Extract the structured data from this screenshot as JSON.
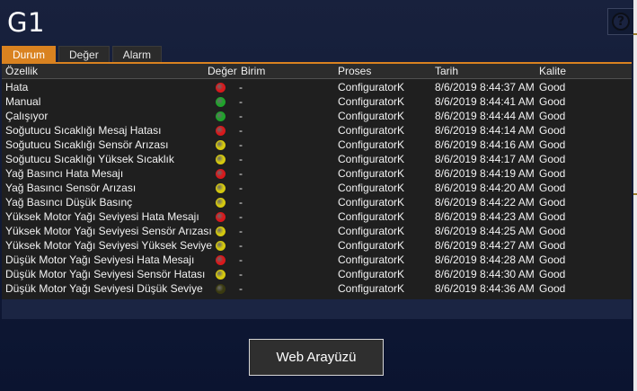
{
  "window": {
    "title": "G1"
  },
  "tabs": [
    {
      "label": "Durum",
      "active": true
    },
    {
      "label": "Değer",
      "active": false
    },
    {
      "label": "Alarm",
      "active": false
    }
  ],
  "table": {
    "columns": [
      "Özellik",
      "Değer",
      "Birim",
      "Proses",
      "Tarih",
      "Kalite"
    ],
    "rows": [
      {
        "name": "Hata",
        "state": "red",
        "unit": "-",
        "process": "ConfiguratorK",
        "date": "8/6/2019 8:44:37 AM",
        "quality": "Good"
      },
      {
        "name": "Manual",
        "state": "green",
        "unit": "-",
        "process": "ConfiguratorK",
        "date": "8/6/2019 8:44:41 AM",
        "quality": "Good"
      },
      {
        "name": "Çalışıyor",
        "state": "green",
        "unit": "-",
        "process": "ConfiguratorK",
        "date": "8/6/2019 8:44:44 AM",
        "quality": "Good"
      },
      {
        "name": "Soğutucu Sıcaklığı Mesaj Hatası",
        "state": "red",
        "unit": "-",
        "process": "ConfiguratorK",
        "date": "8/6/2019 8:44:14 AM",
        "quality": "Good"
      },
      {
        "name": "Soğutucu Sıcaklığı Sensör Arızası",
        "state": "yellow",
        "unit": "-",
        "process": "ConfiguratorK",
        "date": "8/6/2019 8:44:16 AM",
        "quality": "Good"
      },
      {
        "name": "Soğutucu Sıcaklığı Yüksek Sıcaklık",
        "state": "yellow",
        "unit": "-",
        "process": "ConfiguratorK",
        "date": "8/6/2019 8:44:17 AM",
        "quality": "Good"
      },
      {
        "name": "Yağ Basıncı Hata Mesajı",
        "state": "red",
        "unit": "-",
        "process": "ConfiguratorK",
        "date": "8/6/2019 8:44:19 AM",
        "quality": "Good"
      },
      {
        "name": "Yağ Basıncı Sensör Arızası",
        "state": "yellow",
        "unit": "-",
        "process": "ConfiguratorK",
        "date": "8/6/2019 8:44:20 AM",
        "quality": "Good"
      },
      {
        "name": "Yağ Basıncı Düşük Basınç",
        "state": "yellow",
        "unit": "-",
        "process": "ConfiguratorK",
        "date": "8/6/2019 8:44:22 AM",
        "quality": "Good"
      },
      {
        "name": "Yüksek Motor Yağı Seviyesi Hata Mesajı",
        "state": "red",
        "unit": "-",
        "process": "ConfiguratorK",
        "date": "8/6/2019 8:44:23 AM",
        "quality": "Good"
      },
      {
        "name": "Yüksek Motor Yağı Seviyesi Sensör Arızası",
        "state": "yellow",
        "unit": "-",
        "process": "ConfiguratorK",
        "date": "8/6/2019 8:44:25 AM",
        "quality": "Good"
      },
      {
        "name": "Yüksek Motor Yağı Seviyesi Yüksek Seviye",
        "state": "yellow",
        "unit": "-",
        "process": "ConfiguratorK",
        "date": "8/6/2019 8:44:27 AM",
        "quality": "Good"
      },
      {
        "name": "Düşük Motor Yağı Seviyesi Hata Mesajı",
        "state": "red",
        "unit": "-",
        "process": "ConfiguratorK",
        "date": "8/6/2019 8:44:28 AM",
        "quality": "Good"
      },
      {
        "name": "Düşük Motor Yağı Seviyesi Sensör Hatası",
        "state": "yellow",
        "unit": "-",
        "process": "ConfiguratorK",
        "date": "8/6/2019 8:44:30 AM",
        "quality": "Good"
      },
      {
        "name": "Düşük Motor Yağı Seviyesi Düşük Seviye",
        "state": "off",
        "unit": "-",
        "process": "ConfiguratorK",
        "date": "8/6/2019 8:44:36 AM",
        "quality": "Good"
      }
    ]
  },
  "led_colors": {
    "red": "#d8191c",
    "green": "#1fa32a",
    "yellow": "#d4c80f",
    "off": "#3a3a10"
  },
  "footer": {
    "web_button_label": "Web Arayüzü"
  },
  "colors": {
    "accent": "#d98220",
    "background": "#0f1a33"
  }
}
